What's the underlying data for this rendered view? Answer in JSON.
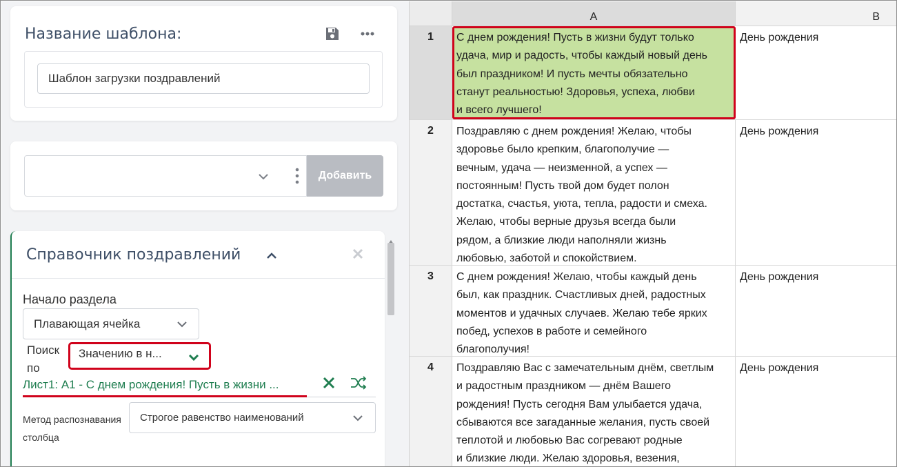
{
  "template": {
    "title": "Название шаблона:",
    "name_value": "Шаблон загрузки поздравлений"
  },
  "add_bar": {
    "select_value": "",
    "add_label": "Добавить"
  },
  "section": {
    "title": "Справочник поздравлений",
    "start_label": "Начало раздела",
    "start_value": "Плавающая ячейка",
    "search_label": "Поиск по",
    "search_value": "Значению в н...",
    "reference": "Лист1: A1 - С днем рождения! Пусть в жизни ...",
    "method_label": "Метод распознавания столбца",
    "method_value": "Строгое равенство наименований"
  },
  "colors": {
    "accent_green": "#1e7d4f",
    "highlight_red": "#d0021b",
    "selected_cell": "#c6e1a0"
  },
  "sheet": {
    "columns": [
      "A",
      "B"
    ],
    "rows": [
      {
        "num": "1",
        "a": "С днем рождения! Пусть в жизни будут только\nудача, мир и радость, чтобы каждый новый день\nбыл праздником! И пусть мечты обязательно\nстанут реальностью! Здоровья, успеха, любви\nи всего лучшего!",
        "b": "День рождения"
      },
      {
        "num": "2",
        "a": "Поздравляю с днем рождения! Желаю, чтобы\nздоровье было крепким, благополучие —\nвечным, удача — неизменной, а успех —\nпостоянным! Пусть твой дом будет полон\nдостатка, счастья, уюта, тепла, радости и смеха.\nЖелаю, чтобы верные друзья всегда были\nрядом, а близкие люди наполняли жизнь\nлюбовью, заботой и спокойствием.",
        "b": "День рождения"
      },
      {
        "num": "3",
        "a": "С днем рождения! Желаю, чтобы каждый день\nбыл, как праздник. Счастливых дней, радостных\nмоментов и удачных случаев. Желаю тебе ярких\nпобед, успехов в работе и семейного\nблагополучия!",
        "b": "День рождения"
      },
      {
        "num": "4",
        "a": "Поздравляю Вас с замечательным днём, светлым\nи радостным праздником — днём Вашего\nрождения! Пусть сегодня Вам улыбается удача,\nсбываются все загаданные желания, пусть своей\nтеплотой и любовью Вас согревают родные\nи близкие люди. Желаю здоровья, везения,",
        "b": "День рождения"
      }
    ]
  }
}
